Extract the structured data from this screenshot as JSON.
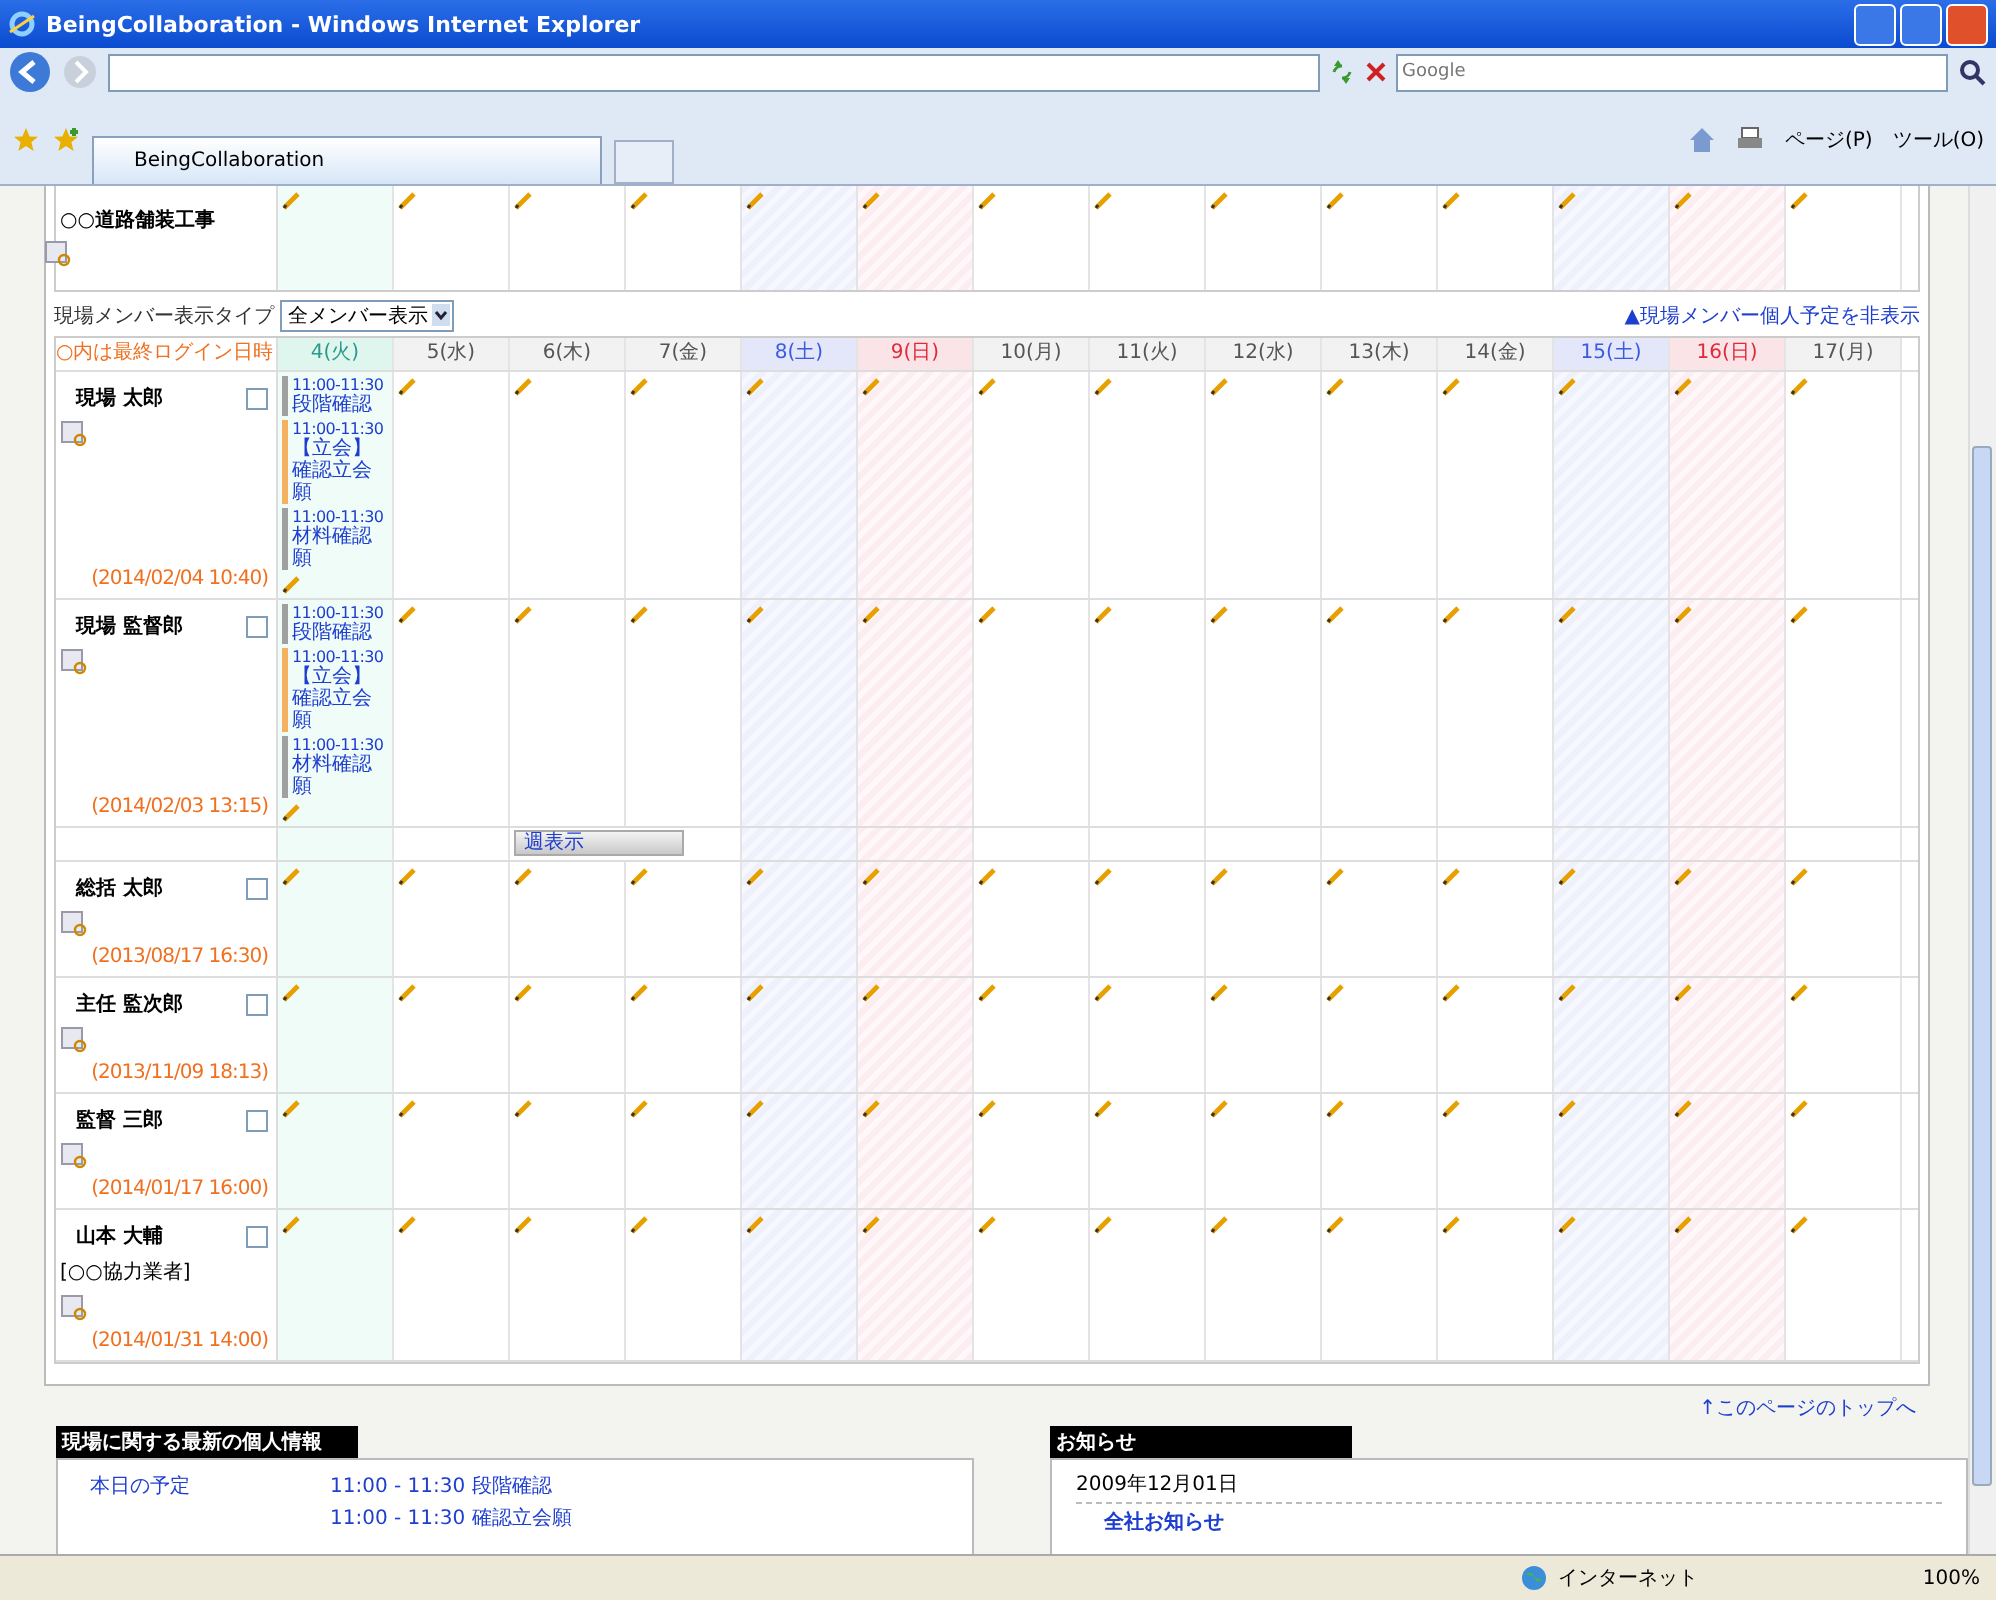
{
  "window": {
    "title": "BeingCollaboration - Windows Internet Explorer"
  },
  "browser": {
    "search_placeholder": "Google",
    "tab": "BeingCollaboration",
    "page_menu": "ページ(P)",
    "tools_menu": "ツール(O)"
  },
  "project": {
    "name": "○○道路舗装工事"
  },
  "display_type": {
    "label": "現場メンバー表示タイプ",
    "value": "全メンバー表示",
    "hide_link": "▲現場メンバー個人予定を非表示"
  },
  "calendar": {
    "corner": "○内は最終ログイン日時",
    "days": [
      {
        "label": "4(火)",
        "kind": "today"
      },
      {
        "label": "5(水)",
        "kind": "weekday"
      },
      {
        "label": "6(木)",
        "kind": "weekday"
      },
      {
        "label": "7(金)",
        "kind": "weekday"
      },
      {
        "label": "8(土)",
        "kind": "sat"
      },
      {
        "label": "9(日)",
        "kind": "sun"
      },
      {
        "label": "10(月)",
        "kind": "weekday"
      },
      {
        "label": "11(火)",
        "kind": "weekday"
      },
      {
        "label": "12(水)",
        "kind": "weekday"
      },
      {
        "label": "13(木)",
        "kind": "weekday"
      },
      {
        "label": "14(金)",
        "kind": "weekday"
      },
      {
        "label": "15(土)",
        "kind": "sat"
      },
      {
        "label": "16(日)",
        "kind": "sun"
      },
      {
        "label": "17(月)",
        "kind": "weekday"
      }
    ],
    "members": [
      {
        "name": "現場 太郎",
        "last_login": "(2014/02/04 10:40)",
        "checked": false,
        "events": [
          {
            "time": "11:00-11:30",
            "title": "段階確認",
            "color": "#a0a0a0"
          },
          {
            "time": "11:00-11:30",
            "title": "【立会】確認立会願",
            "color": "#f5b060"
          },
          {
            "time": "11:00-11:30",
            "title": "材料確認願",
            "color": "#a0a0a0"
          }
        ]
      },
      {
        "name": "現場 監督郎",
        "last_login": "(2014/02/03 13:15)",
        "checked": false,
        "week_button": "週表示",
        "events": [
          {
            "time": "11:00-11:30",
            "title": "段階確認",
            "color": "#a0a0a0"
          },
          {
            "time": "11:00-11:30",
            "title": "【立会】確認立会願",
            "color": "#f5b060"
          },
          {
            "time": "11:00-11:30",
            "title": "材料確認願",
            "color": "#a0a0a0"
          }
        ]
      },
      {
        "name": "総括 太郎",
        "last_login": "(2013/08/17 16:30)",
        "checked": false
      },
      {
        "name": "主任 監次郎",
        "last_login": "(2013/11/09 18:13)",
        "checked": false
      },
      {
        "name": "監督 三郎",
        "last_login": "(2014/01/17 16:00)",
        "checked": false
      },
      {
        "name": "山本 大輔",
        "affiliation": "[○○協力業者]",
        "last_login": "(2014/01/31 14:00)",
        "checked": false
      }
    ]
  },
  "page_top_link": "↑このページのトップへ",
  "personal_panel": {
    "title": "現場に関する最新の個人情報",
    "label": "本日の予定",
    "items": [
      "11:00 - 11:30 段階確認",
      "11:00 - 11:30 確認立会願"
    ]
  },
  "notice_panel": {
    "title": "お知らせ",
    "date": "2009年12月01日",
    "item": "全社お知らせ"
  },
  "status_bar": {
    "zone": "インターネット",
    "zoom": "100%"
  }
}
